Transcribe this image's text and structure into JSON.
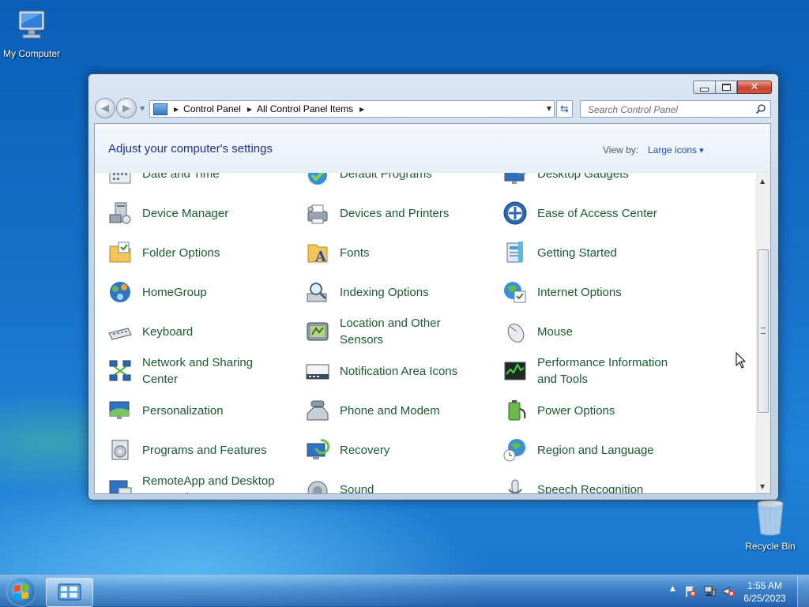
{
  "desktop": {
    "my_computer": "My Computer",
    "recycle_bin": "Recycle Bin"
  },
  "window": {
    "title_buttons": {
      "minimize": "minimize-icon",
      "maximize": "maximize-icon",
      "close": "close-icon"
    },
    "breadcrumb": [
      "Control Panel",
      "All Control Panel Items"
    ],
    "search_placeholder": "Search Control Panel",
    "heading": "Adjust your computer's settings",
    "view_by_label": "View by:",
    "view_by_value": "Large icons",
    "items": [
      {
        "label": "Date and Time",
        "icon": "clock-calendar-icon"
      },
      {
        "label": "Default Programs",
        "icon": "default-programs-icon"
      },
      {
        "label": "Desktop Gadgets",
        "icon": "gadgets-icon"
      },
      {
        "label": "Device Manager",
        "icon": "device-manager-icon"
      },
      {
        "label": "Devices and Printers",
        "icon": "printer-icon"
      },
      {
        "label": "Ease of Access Center",
        "icon": "ease-of-access-icon"
      },
      {
        "label": "Folder Options",
        "icon": "folder-options-icon"
      },
      {
        "label": "Fonts",
        "icon": "fonts-icon"
      },
      {
        "label": "Getting Started",
        "icon": "getting-started-icon"
      },
      {
        "label": "HomeGroup",
        "icon": "homegroup-icon"
      },
      {
        "label": "Indexing Options",
        "icon": "indexing-icon"
      },
      {
        "label": "Internet Options",
        "icon": "internet-options-icon"
      },
      {
        "label": "Keyboard",
        "icon": "keyboard-icon"
      },
      {
        "label": "Location and Other Sensors",
        "icon": "location-sensors-icon"
      },
      {
        "label": "Mouse",
        "icon": "mouse-icon"
      },
      {
        "label": "Network and Sharing Center",
        "icon": "network-icon"
      },
      {
        "label": "Notification Area Icons",
        "icon": "notification-area-icon"
      },
      {
        "label": "Performance Information and Tools",
        "icon": "performance-icon"
      },
      {
        "label": "Personalization",
        "icon": "personalization-icon"
      },
      {
        "label": "Phone and Modem",
        "icon": "phone-modem-icon"
      },
      {
        "label": "Power Options",
        "icon": "power-options-icon"
      },
      {
        "label": "Programs and Features",
        "icon": "programs-features-icon"
      },
      {
        "label": "Recovery",
        "icon": "recovery-icon"
      },
      {
        "label": "Region and Language",
        "icon": "region-language-icon"
      },
      {
        "label": "RemoteApp and Desktop Connections",
        "icon": "remoteapp-icon"
      },
      {
        "label": "Sound",
        "icon": "sound-icon"
      },
      {
        "label": "Speech Recognition",
        "icon": "speech-recognition-icon"
      }
    ]
  },
  "taskbar": {
    "time": "1:55 AM",
    "date": "6/25/2023"
  },
  "colors": {
    "link_green": "#1a5a2e",
    "heading_blue": "#1e3287",
    "view_by_blue": "#1e50a2"
  }
}
